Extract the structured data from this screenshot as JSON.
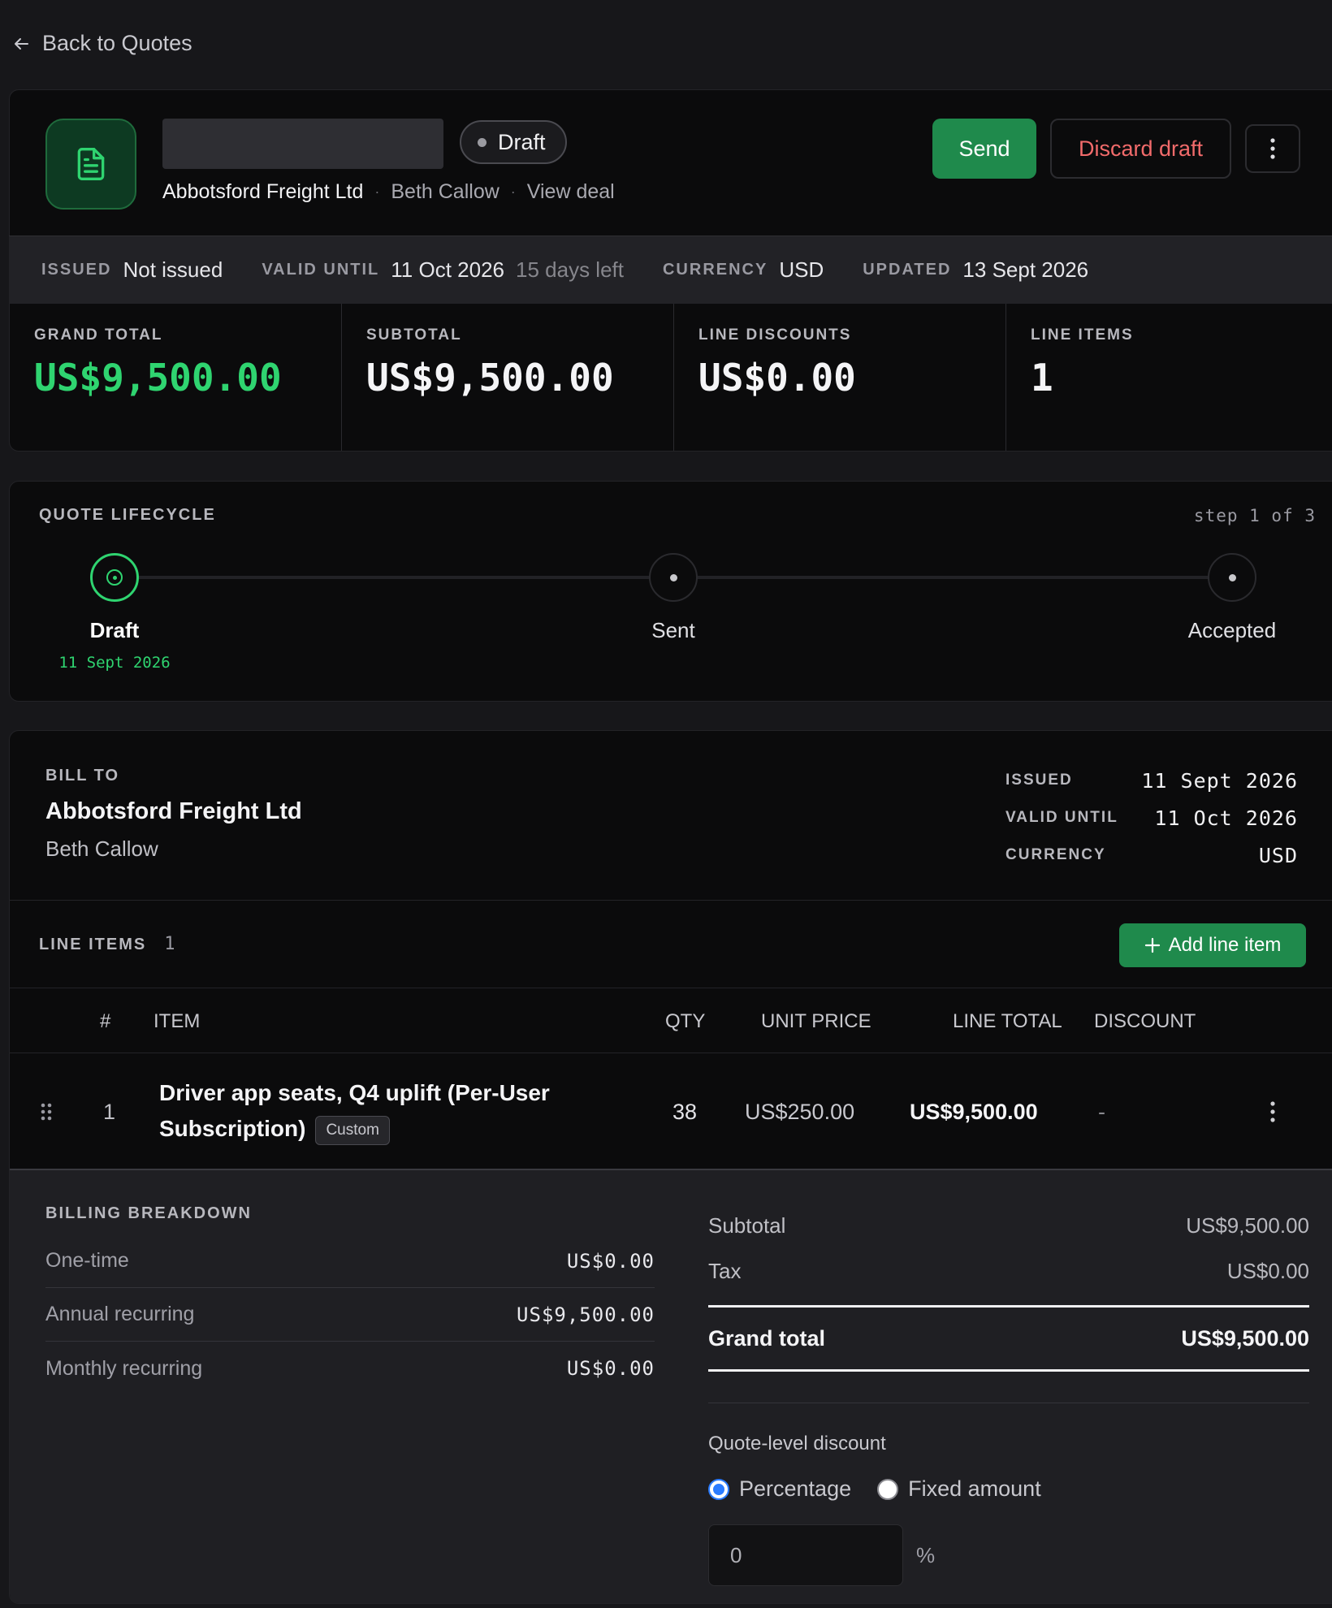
{
  "nav": {
    "back_label": "Back to Quotes"
  },
  "header": {
    "status": "Draft",
    "company": "Abbotsford Freight Ltd",
    "contact": "Beth Callow",
    "view_deal": "View deal",
    "send_label": "Send",
    "discard_label": "Discard draft"
  },
  "info_strip": {
    "issued_label": "ISSUED",
    "issued_value": "Not issued",
    "valid_label": "VALID UNTIL",
    "valid_value": "11 Oct 2026",
    "valid_note": "15 days left",
    "currency_label": "CURRENCY",
    "currency_value": "USD",
    "updated_label": "UPDATED",
    "updated_value": "13 Sept 2026"
  },
  "stats": [
    {
      "label": "GRAND TOTAL",
      "value": "US$9,500.00"
    },
    {
      "label": "SUBTOTAL",
      "value": "US$9,500.00"
    },
    {
      "label": "LINE DISCOUNTS",
      "value": "US$0.00"
    },
    {
      "label": "LINE ITEMS",
      "value": "1"
    }
  ],
  "lifecycle": {
    "title": "QUOTE LIFECYCLE",
    "step_text": "step 1 of 3",
    "steps": [
      {
        "label": "Draft",
        "date": "11 Sept 2026"
      },
      {
        "label": "Sent"
      },
      {
        "label": "Accepted"
      }
    ]
  },
  "bill": {
    "bill_to_label": "BILL TO",
    "company": "Abbotsford Freight Ltd",
    "contact": "Beth Callow",
    "issued_label": "ISSUED",
    "issued_value": "11 Sept 2026",
    "valid_label": "VALID UNTIL",
    "valid_value": "11 Oct 2026",
    "currency_label": "CURRENCY",
    "currency_value": "USD"
  },
  "line_items": {
    "title": "LINE ITEMS",
    "count": "1",
    "add_label": "Add line item",
    "columns": [
      "#",
      "ITEM",
      "QTY",
      "UNIT PRICE",
      "LINE TOTAL",
      "DISCOUNT"
    ],
    "rows": [
      {
        "num": "1",
        "name": "Driver app seats, Q4 uplift (Per-User Subscription)",
        "tag": "Custom",
        "qty": "38",
        "unit_price": "US$250.00",
        "line_total": "US$9,500.00",
        "discount": "-"
      }
    ]
  },
  "breakdown": {
    "title": "BILLING BREAKDOWN",
    "rows": [
      {
        "label": "One-time",
        "value": "US$0.00"
      },
      {
        "label": "Annual recurring",
        "value": "US$9,500.00"
      },
      {
        "label": "Monthly recurring",
        "value": "US$0.00"
      }
    ]
  },
  "summary": {
    "subtotal_label": "Subtotal",
    "subtotal_value": "US$9,500.00",
    "tax_label": "Tax",
    "tax_value": "US$0.00",
    "grand_label": "Grand total",
    "grand_value": "US$9,500.00"
  },
  "quote_discount": {
    "title": "Quote-level discount",
    "option_percentage": "Percentage",
    "option_fixed": "Fixed amount",
    "selected": "Percentage",
    "value": "0",
    "unit": "%"
  },
  "colors": {
    "accent_green": "#2fd470",
    "button_green": "#1f8a4c",
    "danger": "#f26b6b",
    "radio_blue": "#2b7cff"
  }
}
